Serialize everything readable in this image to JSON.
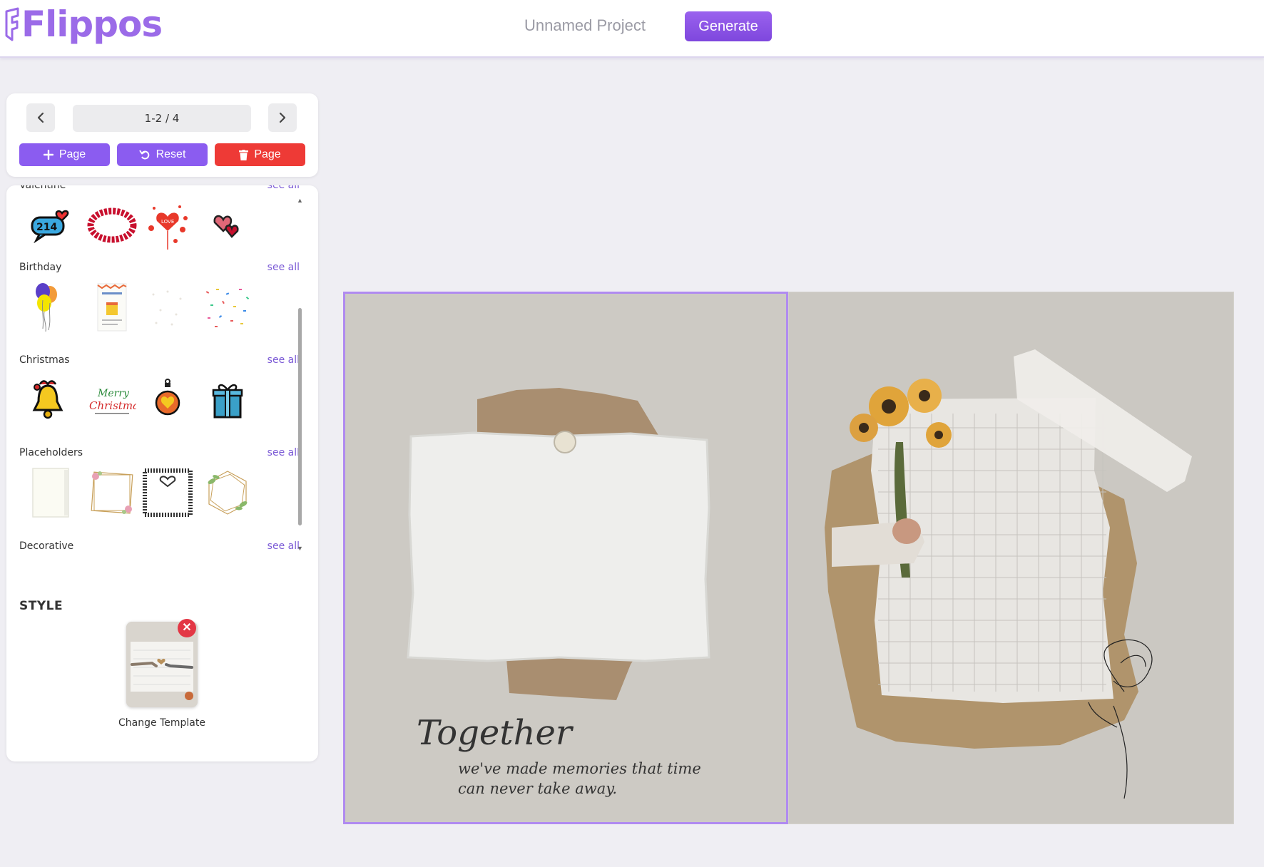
{
  "header": {
    "logo_text": "Flippos",
    "project_title": "Unnamed Project",
    "generate_label": "Generate"
  },
  "pager": {
    "page_indicator": "1-2 / 4",
    "add_page_label": "Page",
    "reset_label": "Reset",
    "delete_page_label": "Page"
  },
  "stickers": {
    "see_all_label": "see all",
    "categories": [
      {
        "title": "Valentine",
        "items": [
          "214-heart-bubble-icon",
          "rose-wreath-icon",
          "love-heart-balloon-icon",
          "double-heart-icon"
        ]
      },
      {
        "title": "Birthday",
        "items": [
          "balloons-icon",
          "birthday-card-icon",
          "confetti-light-icon",
          "confetti-icon"
        ]
      },
      {
        "title": "Christmas",
        "items": [
          "christmas-bell-icon",
          "merry-christmas-text-icon",
          "ornament-icon",
          "gift-box-icon"
        ]
      },
      {
        "title": "Placeholders",
        "items": [
          "plain-frame-icon",
          "floral-frame-icon",
          "lace-heart-frame-icon",
          "leaf-hexagon-frame-icon"
        ]
      },
      {
        "title": "Decorative",
        "items": []
      }
    ]
  },
  "style": {
    "title": "STYLE",
    "change_template_label": "Change Template",
    "remove_symbol": "✕"
  },
  "canvas": {
    "left_page": {
      "caption_title": "Together",
      "caption_text": "we've made memories that time can never take away."
    }
  },
  "colors": {
    "accent": "#8b5cf0",
    "danger": "#ee3a36",
    "selection_border": "#b08af0",
    "background": "#efeef3"
  }
}
